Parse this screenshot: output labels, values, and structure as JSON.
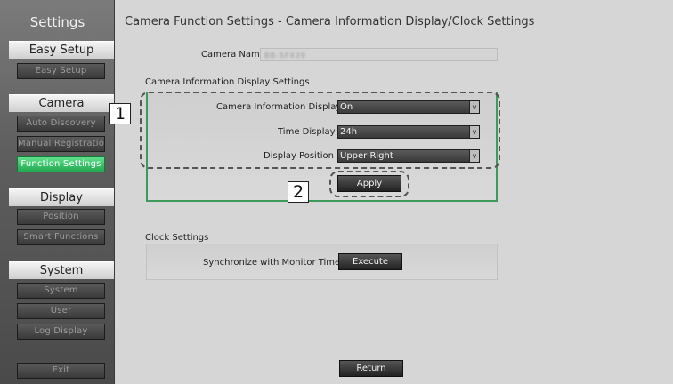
{
  "sidebar": {
    "title": "Settings",
    "sections": [
      {
        "label": "Easy Setup",
        "items": [
          {
            "label": "Easy Setup",
            "active": false
          }
        ]
      },
      {
        "label": "Camera",
        "items": [
          {
            "label": "Auto Discovery",
            "active": false
          },
          {
            "label": "Manual Registration",
            "active": false
          },
          {
            "label": "Function Settings",
            "active": true
          }
        ]
      },
      {
        "label": "Display",
        "items": [
          {
            "label": "Position",
            "active": false
          },
          {
            "label": "Smart Functions",
            "active": false
          }
        ]
      },
      {
        "label": "System",
        "items": [
          {
            "label": "System",
            "active": false
          },
          {
            "label": "User",
            "active": false
          },
          {
            "label": "Log Display",
            "active": false
          }
        ]
      }
    ],
    "exit_label": "Exit"
  },
  "main": {
    "title": "Camera Function Settings - Camera Information Display/Clock Settings",
    "camera_name": {
      "label": "Camera Name",
      "value": "BB-SF439"
    },
    "info_section": {
      "heading": "Camera Information Display Settings",
      "fields": [
        {
          "label": "Camera Information Display",
          "value": "On"
        },
        {
          "label": "Time Display",
          "value": "24h"
        },
        {
          "label": "Display Position",
          "value": "Upper Right"
        }
      ],
      "dropdown_arrow": "v",
      "apply_label": "Apply"
    },
    "clock_section": {
      "heading": "Clock Settings",
      "sync_label": "Synchronize with Monitor Time",
      "execute_label": "Execute"
    },
    "return_label": "Return"
  },
  "callouts": [
    "1",
    "2"
  ],
  "colors": {
    "active_green": "#21a950",
    "panel_border_green": "#3c9a5a"
  }
}
